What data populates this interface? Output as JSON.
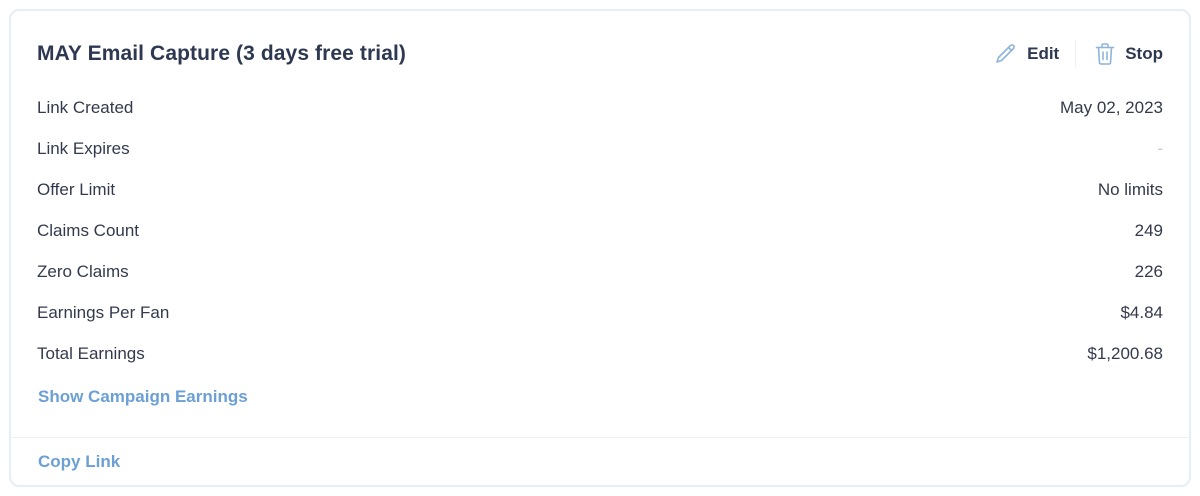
{
  "card": {
    "title": "MAY Email Capture (3 days free trial)",
    "actions": {
      "edit_label": "Edit",
      "edit_icon": "pencil-icon",
      "stop_label": "Stop",
      "stop_icon": "trash-icon"
    },
    "rows": [
      {
        "label": "Link Created",
        "value": "May 02, 2023"
      },
      {
        "label": "Link Expires",
        "value": "-"
      },
      {
        "label": "Offer Limit",
        "value": "No limits"
      },
      {
        "label": "Claims Count",
        "value": "249"
      },
      {
        "label": "Zero Claims",
        "value": "226"
      },
      {
        "label": "Earnings Per Fan",
        "value": "$4.84"
      },
      {
        "label": "Total Earnings",
        "value": "$1,200.68"
      }
    ],
    "show_earnings_label": "Show Campaign Earnings",
    "copy_link_label": "Copy Link"
  },
  "colors": {
    "accent_link": "#6c9fd4",
    "text_primary": "#2e3850",
    "border": "#e4f0f8",
    "muted_value": "#c3c8d1"
  }
}
